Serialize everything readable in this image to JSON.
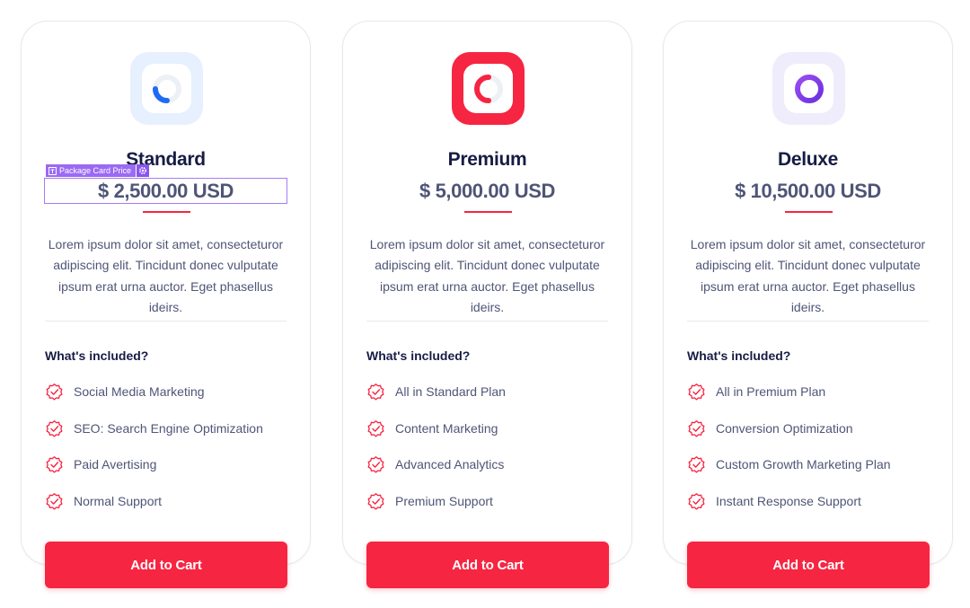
{
  "cards": [
    {
      "name": "Standard",
      "price": "$ 2,500.00 USD",
      "description": "Lorem ipsum dolor sit amet, consecteturor adipiscing elit. Tincidunt donec vulputate ipsum erat urna auctor. Eget phasellus ideirs.",
      "included_title": "What's included?",
      "features": [
        "Social Media Marketing",
        "SEO: Search Engine Optimization",
        "Paid Avertising",
        "Normal Support"
      ],
      "button_label": "Add to Cart",
      "icon": "ring-quarter-icon",
      "accent_color": "#1f6bf5"
    },
    {
      "name": "Premium",
      "price": "$ 5,000.00 USD",
      "description": "Lorem ipsum dolor sit amet, consecteturor adipiscing elit. Tincidunt donec vulputate ipsum erat urna auctor. Eget phasellus ideirs.",
      "included_title": "What's included?",
      "features": [
        "All in Standard Plan",
        "Content Marketing",
        "Advanced Analytics",
        "Premium Support"
      ],
      "button_label": "Add to Cart",
      "icon": "ring-half-icon",
      "accent_color": "#f62542"
    },
    {
      "name": "Deluxe",
      "price": "$ 10,500.00 USD",
      "description": "Lorem ipsum dolor sit amet, consecteturor adipiscing elit. Tincidunt donec vulputate ipsum erat urna auctor. Eget phasellus ideirs.",
      "included_title": "What's included?",
      "features": [
        "All in Premium Plan",
        "Conversion Optimization",
        "Custom Growth Marketing Plan",
        "Instant Response Support"
      ],
      "button_label": "Add to Cart",
      "icon": "ring-full-icon",
      "accent_color": "#7b33e6"
    }
  ],
  "editor_tag": {
    "label": "Package Card Price",
    "icon": "gear-icon"
  },
  "colors": {
    "brand_red": "#f62542",
    "heading": "#171c45",
    "body_text": "#4f5577",
    "selection_outline": "#a57cf5"
  }
}
